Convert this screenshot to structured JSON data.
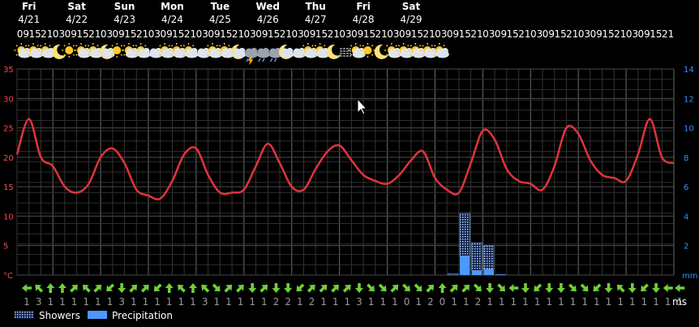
{
  "chart_data": {
    "type": "line+bar",
    "days": [
      {
        "name": "Fri",
        "date": "4/21"
      },
      {
        "name": "Sat",
        "date": "4/22"
      },
      {
        "name": "Sun",
        "date": "4/23"
      },
      {
        "name": "Mon",
        "date": "4/24"
      },
      {
        "name": "Tue",
        "date": "4/25"
      },
      {
        "name": "Wed",
        "date": "4/26"
      },
      {
        "name": "Thu",
        "date": "4/27"
      },
      {
        "name": "Fri",
        "date": "4/28"
      },
      {
        "name": "Sat",
        "date": "4/29"
      }
    ],
    "hours": [
      "09",
      "15",
      "21",
      "03",
      "09",
      "15",
      "21",
      "03",
      "09",
      "15",
      "21",
      "03",
      "09",
      "15",
      "21",
      "03",
      "09",
      "15",
      "21",
      "03",
      "09",
      "15",
      "21",
      "03",
      "09",
      "15",
      "21",
      "03",
      "09",
      "15",
      "21",
      "03",
      "09",
      "15",
      "21",
      "03",
      "09",
      "15",
      "21",
      "03",
      "09",
      "15",
      "21",
      "03",
      "09",
      "15",
      "21",
      "03",
      "09",
      "15",
      "21",
      "03",
      "09",
      "15",
      "21"
    ],
    "weather_icons": [
      "sun-cloud-icon",
      "sun-cloud-icon",
      "sun-cloud-icon",
      "moon-icon",
      "sun-icon",
      "sun-cloud-icon",
      "sun-cloud-icon",
      "moon-cloud-icon",
      "sun-icon",
      "sun-cloud-icon",
      "sun-cloud-icon",
      "cloud-icon",
      "sun-cloud-icon",
      "sun-cloud-icon",
      "sun-cloud-icon",
      "cloud-icon",
      "sun-cloud-icon",
      "sun-cloud-icon",
      "moon-cloud-icon",
      "thunder-shower-icon",
      "shower-icon",
      "shower-icon",
      "moon-cloud-icon",
      "cloud-icon",
      "sun-cloud-icon",
      "sun-cloud-icon",
      "moon-icon",
      "fog-icon",
      "sun-cloud-icon",
      "sun-icon",
      "moon-icon",
      "sun-cloud-icon",
      "sun-cloud-icon",
      "sun-cloud-icon",
      "sun-cloud-icon",
      "sun-cloud-icon"
    ],
    "temperature_c": [
      20.5,
      26.5,
      20,
      18.5,
      15,
      14,
      15.5,
      20,
      21.5,
      19,
      14.5,
      13.5,
      13,
      16,
      20.5,
      21.5,
      17,
      14,
      14,
      14.5,
      18.5,
      22.3,
      19,
      15,
      14.5,
      18,
      21,
      22,
      19.5,
      17,
      16,
      15.5,
      17,
      19.5,
      21,
      16.5,
      14.5,
      14,
      19,
      24.5,
      23,
      18,
      16,
      15.5,
      14.5,
      18.5,
      25,
      24,
      19.5,
      17,
      16.5,
      16,
      20.5,
      26.5,
      20,
      19
    ],
    "showers_mm": [
      0,
      0,
      0,
      0,
      0,
      0,
      0,
      0,
      0,
      0,
      0,
      0,
      0,
      0,
      0,
      0,
      0,
      0,
      0,
      0,
      0,
      0,
      0,
      0,
      0,
      0,
      0,
      0,
      0,
      0,
      0,
      0,
      0,
      0,
      0,
      0,
      0.1,
      2.9,
      1.9,
      1.6,
      0,
      0,
      0,
      0,
      0,
      0,
      0,
      0,
      0,
      0,
      0,
      0,
      0,
      0,
      0,
      0
    ],
    "precipitation_mm": [
      0,
      0,
      0,
      0,
      0,
      0,
      0,
      0,
      0,
      0,
      0,
      0,
      0,
      0,
      0,
      0,
      0,
      0,
      0,
      0,
      0,
      0,
      0,
      0,
      0,
      0,
      0,
      0,
      0,
      0,
      0,
      0,
      0,
      0,
      0,
      0,
      0,
      1.3,
      0.3,
      0.4,
      0.05,
      0,
      0,
      0,
      0,
      0,
      0,
      0,
      0,
      0,
      0,
      0,
      0,
      0,
      0,
      0
    ],
    "left_axis": {
      "unit": "°C",
      "ticks": [
        "0",
        "5",
        "10",
        "15",
        "20",
        "25",
        "30",
        "35"
      ],
      "ylim": [
        0,
        35
      ]
    },
    "right_axis": {
      "unit": "mm",
      "ticks": [
        "2",
        "4",
        "6",
        "8",
        "10",
        "12",
        "14"
      ],
      "ylim": [
        0,
        14
      ]
    },
    "wind": {
      "unit": "ms",
      "directions": [
        "W",
        "NW",
        "N",
        "N",
        "NE",
        "NW",
        "NE",
        "SW",
        "S",
        "NE",
        "NE",
        "SW",
        "N",
        "NW",
        "N",
        "NW",
        "SE",
        "NE",
        "NE",
        "S",
        "NE",
        "S",
        "S",
        "SW",
        "NE",
        "NE",
        "NE",
        "NE",
        "S",
        "SE",
        "SE",
        "NE",
        "SE",
        "SE",
        "NE",
        "N",
        "NE",
        "NE",
        "SE",
        "S",
        "SE",
        "W",
        "S",
        "SW",
        "S",
        "S",
        "SE",
        "SE",
        "SW",
        "S",
        "NW",
        "S",
        "SW",
        "S",
        "W",
        "W"
      ],
      "speeds": [
        "1",
        "3",
        "1",
        "1",
        "1",
        "1",
        "1",
        "1",
        "3",
        "1",
        "1",
        "1",
        "1",
        "1",
        "1",
        "3",
        "1",
        "1",
        "1",
        "1",
        "1",
        "2",
        "2",
        "1",
        "2",
        "1",
        "1",
        "1",
        "3",
        "1",
        "1",
        "1",
        "0",
        "1",
        "2",
        "0",
        "1",
        "1",
        "2",
        "1",
        "1",
        "1",
        "1",
        "1",
        "1",
        "1",
        "1",
        "1",
        "1",
        "1",
        "1",
        "1",
        "1",
        "1",
        "1",
        "1"
      ]
    },
    "legend": [
      {
        "name": "Showers",
        "color": "#6fa3ff",
        "pattern": "dotted"
      },
      {
        "name": "Precipitation",
        "color": "#4d97ff"
      }
    ],
    "grid": true
  },
  "colors": {
    "temperature_line": "#e0343d",
    "grid": "#3a3a3a",
    "wind_arrow": "#6fcf3a",
    "right_axis": "#3d8cff",
    "left_axis": "#ff4a4a"
  },
  "cursor": {
    "visible": true
  }
}
